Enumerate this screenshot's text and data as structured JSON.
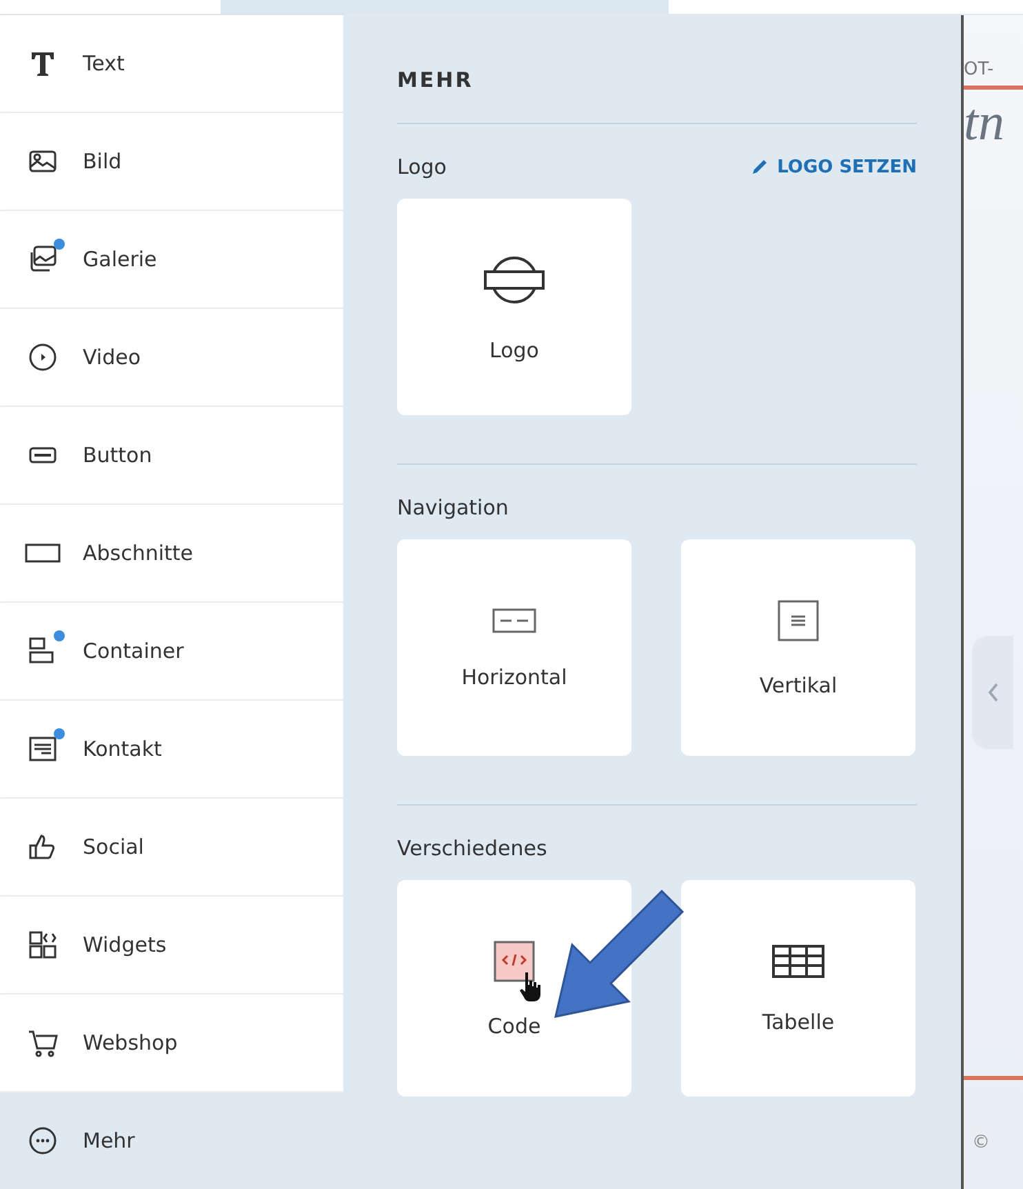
{
  "sidebar": {
    "items": [
      {
        "label": "Text",
        "kind": "text",
        "badge": false,
        "selected": false
      },
      {
        "label": "Bild",
        "kind": "image",
        "badge": false,
        "selected": false
      },
      {
        "label": "Galerie",
        "kind": "gallery",
        "badge": true,
        "selected": false
      },
      {
        "label": "Video",
        "kind": "video",
        "badge": false,
        "selected": false
      },
      {
        "label": "Button",
        "kind": "button",
        "badge": false,
        "selected": false
      },
      {
        "label": "Abschnitte",
        "kind": "section",
        "badge": false,
        "selected": false
      },
      {
        "label": "Container",
        "kind": "container",
        "badge": true,
        "selected": false
      },
      {
        "label": "Kontakt",
        "kind": "contact",
        "badge": true,
        "selected": false
      },
      {
        "label": "Social",
        "kind": "social",
        "badge": false,
        "selected": false
      },
      {
        "label": "Widgets",
        "kind": "widgets",
        "badge": false,
        "selected": false
      },
      {
        "label": "Webshop",
        "kind": "cart",
        "badge": false,
        "selected": false
      },
      {
        "label": "Mehr",
        "kind": "more",
        "badge": false,
        "selected": true
      }
    ]
  },
  "panel": {
    "title": "MEHR",
    "sections": [
      {
        "title": "Logo",
        "action": "LOGO SETZEN",
        "cards": [
          {
            "label": "Logo",
            "kind": "logo",
            "hovered": false
          }
        ]
      },
      {
        "title": "Navigation",
        "cards": [
          {
            "label": "Horizontal",
            "kind": "horizontal",
            "hovered": false
          },
          {
            "label": "Vertikal",
            "kind": "vertical",
            "hovered": false
          }
        ]
      },
      {
        "title": "Verschiedenes",
        "cards": [
          {
            "label": "Code",
            "kind": "code",
            "hovered": true
          },
          {
            "label": "Tabelle",
            "kind": "table",
            "hovered": false
          }
        ]
      }
    ]
  },
  "preview": {
    "label": "OT-",
    "heading": "tn",
    "footer": "©"
  }
}
